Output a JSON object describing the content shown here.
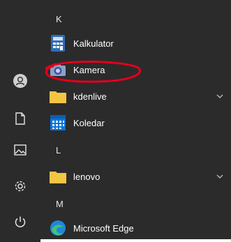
{
  "start_menu": {
    "sections": [
      {
        "letter": "K"
      },
      {
        "letter": "L"
      },
      {
        "letter": "M"
      }
    ],
    "apps": [
      {
        "name": "Kalkulator",
        "icon": "calculator-icon"
      },
      {
        "name": "Kamera",
        "icon": "camera-icon"
      },
      {
        "name": "kdenlive",
        "icon": "folder-icon",
        "expandable": true
      },
      {
        "name": "Koledar",
        "icon": "calendar-icon"
      },
      {
        "name": "lenovo",
        "icon": "folder-icon",
        "expandable": true
      },
      {
        "name": "Microsoft Edge",
        "icon": "edge-icon"
      }
    ]
  },
  "rail": {
    "icons": [
      "user-icon",
      "document-icon",
      "pictures-icon",
      "settings-icon",
      "power-icon"
    ]
  },
  "colors": {
    "background": "#2b2b2b",
    "accent_blue": "#0a74d8",
    "folder_yellow": "#f4c542",
    "annotation_red": "#e3001b"
  }
}
